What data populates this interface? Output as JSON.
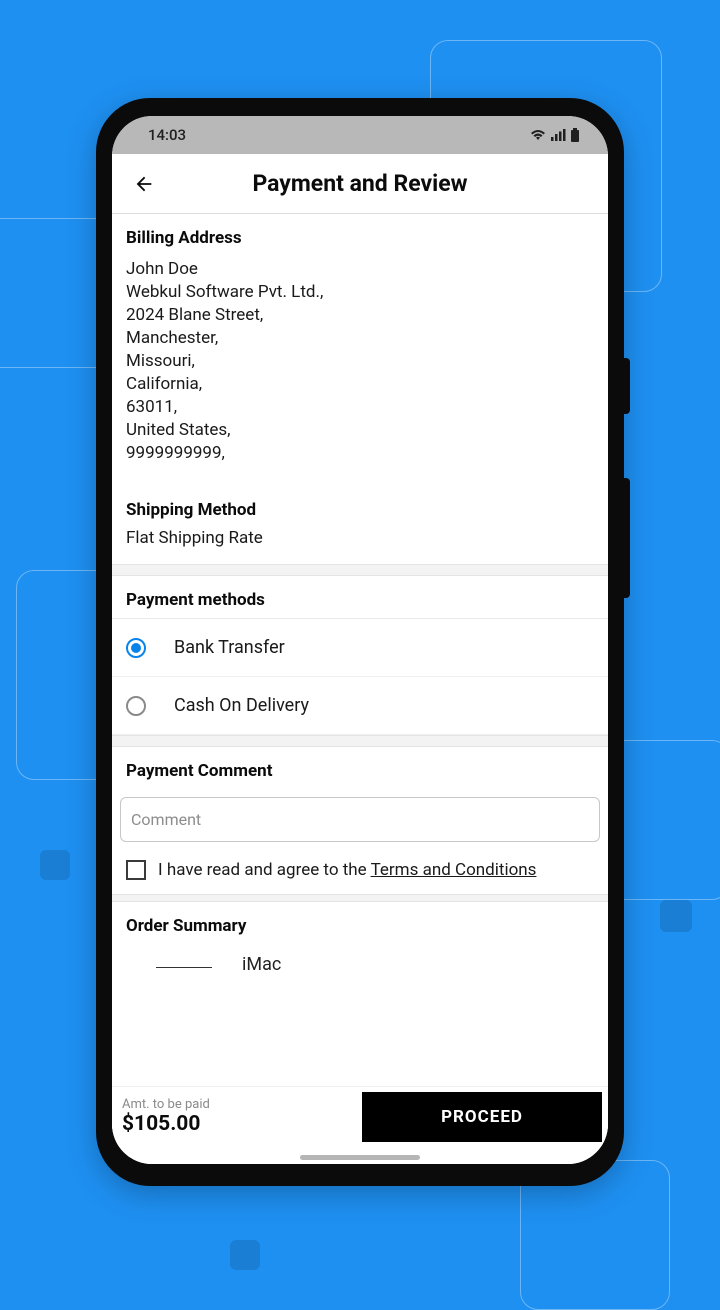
{
  "status": {
    "time": "14:03"
  },
  "header": {
    "title": "Payment and Review"
  },
  "billing": {
    "heading": "Billing Address",
    "name": "John  Doe",
    "company": "Webkul Software Pvt. Ltd.,",
    "street": "2024  Blane Street,",
    "city": "Manchester,",
    "region1": "Missouri,",
    "region2": "California,",
    "zip": "63011,",
    "country": "United States,",
    "phone": "9999999999,"
  },
  "shipping": {
    "heading": "Shipping Method",
    "method": "Flat Shipping Rate"
  },
  "payment_methods": {
    "heading": "Payment methods",
    "options": [
      {
        "label": "Bank Transfer",
        "checked": true
      },
      {
        "label": "Cash On Delivery",
        "checked": false
      }
    ]
  },
  "comment": {
    "heading": "Payment Comment",
    "placeholder": "Comment"
  },
  "terms": {
    "prefix": "I have read and agree to the ",
    "link": "Terms and Conditions"
  },
  "order": {
    "heading": "Order Summary",
    "item_name": "iMac"
  },
  "footer": {
    "amt_label": "Amt. to be paid",
    "amt_value": "$105.00",
    "proceed": "PROCEED"
  }
}
